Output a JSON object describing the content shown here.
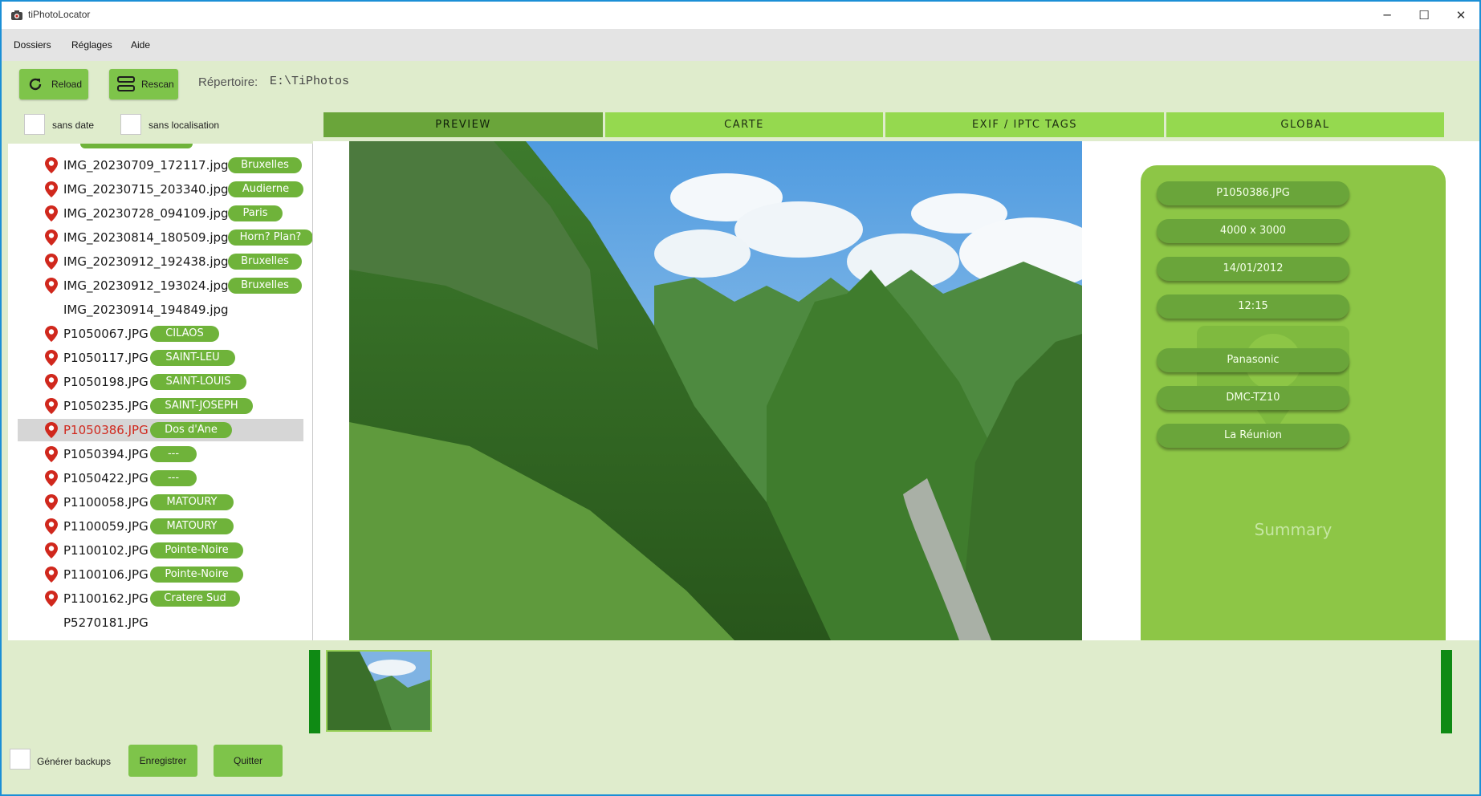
{
  "window": {
    "title": "tiPhotoLocator",
    "minimize_glyph": "─",
    "maximize_glyph": "☐",
    "close_glyph": "✕"
  },
  "menu": [
    "Dossiers",
    "Réglages",
    "Aide"
  ],
  "toolbar": {
    "reload_label": "Reload",
    "rescan_label": "Rescan",
    "repo_label": "Répertoire:",
    "repo_value": "E:\\TiPhotos"
  },
  "filters": {
    "no_date_label": "sans date",
    "no_location_label": "sans localisation"
  },
  "tabs": [
    {
      "label": "PREVIEW",
      "active": true
    },
    {
      "label": "CARTE",
      "active": false
    },
    {
      "label": "EXIF / IPTC TAGS",
      "active": false
    },
    {
      "label": "GLOBAL",
      "active": false
    }
  ],
  "files": [
    {
      "name": "IMG_20230709_172117.jpg",
      "tag": "Bruxelles",
      "pin": true
    },
    {
      "name": "IMG_20230715_203340.jpg",
      "tag": "Audierne",
      "pin": true
    },
    {
      "name": "IMG_20230728_094109.jpg",
      "tag": "Paris",
      "pin": true
    },
    {
      "name": "IMG_20230814_180509.jpg",
      "tag": "Horn? Plan?",
      "pin": true
    },
    {
      "name": "IMG_20230912_192438.jpg",
      "tag": "Bruxelles",
      "pin": true
    },
    {
      "name": "IMG_20230912_193024.jpg",
      "tag": "Bruxelles",
      "pin": true
    },
    {
      "name": "IMG_20230914_194849.jpg",
      "tag": "",
      "pin": false
    },
    {
      "name": "P1050067.JPG",
      "tag": "CILAOS",
      "pin": true
    },
    {
      "name": "P1050117.JPG",
      "tag": "SAINT-LEU",
      "pin": true
    },
    {
      "name": "P1050198.JPG",
      "tag": "SAINT-LOUIS",
      "pin": true
    },
    {
      "name": "P1050235.JPG",
      "tag": "SAINT-JOSEPH",
      "pin": true
    },
    {
      "name": "P1050386.JPG",
      "tag": "Dos d'Ane",
      "pin": true,
      "selected": true
    },
    {
      "name": "P1050394.JPG",
      "tag": "---",
      "pin": true
    },
    {
      "name": "P1050422.JPG",
      "tag": "---",
      "pin": true
    },
    {
      "name": "P1100058.JPG",
      "tag": "MATOURY",
      "pin": true
    },
    {
      "name": "P1100059.JPG",
      "tag": "MATOURY",
      "pin": true
    },
    {
      "name": "P1100102.JPG",
      "tag": "Pointe-Noire",
      "pin": true
    },
    {
      "name": "P1100106.JPG",
      "tag": "Pointe-Noire",
      "pin": true
    },
    {
      "name": "P1100162.JPG",
      "tag": "Cratere Sud",
      "pin": true
    },
    {
      "name": "P5270181.JPG",
      "tag": "",
      "pin": false
    }
  ],
  "summary": {
    "filename": "P1050386.JPG",
    "dimensions": "4000 x 3000",
    "date": "14/01/2012",
    "time": "12:15",
    "make": "Panasonic",
    "model": "DMC-TZ10",
    "location": "La Réunion",
    "title": "Summary"
  },
  "bottom": {
    "backup_label": "Générer backups",
    "save_label": "Enregistrer",
    "quit_label": "Quitter"
  },
  "colors": {
    "accent": "#7ec44a",
    "tab": "#95d94f",
    "tab_active": "#6aa53a",
    "pin": "#d0281d",
    "tag": "#6fb33a",
    "panel": "#8dc646"
  }
}
